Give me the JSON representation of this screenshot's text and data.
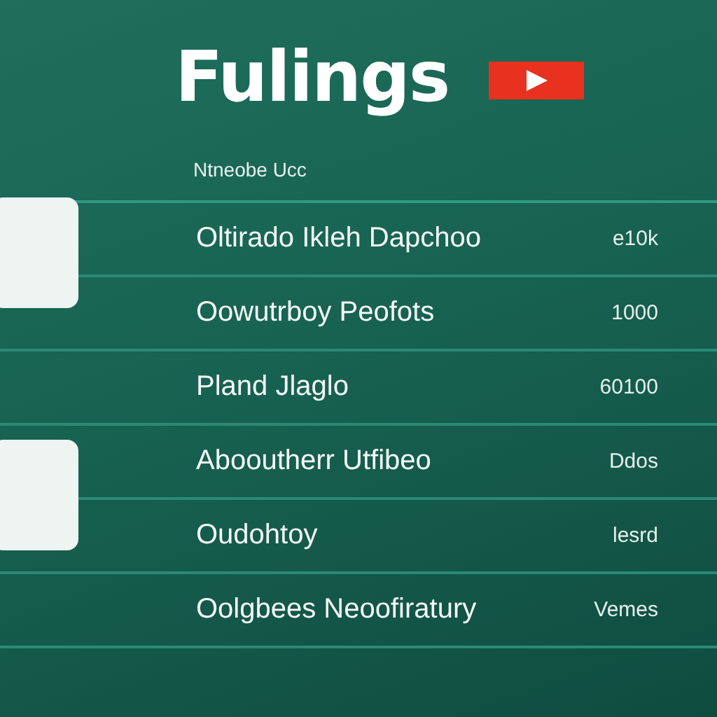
{
  "header": {
    "title": "Fulings",
    "subtitle": "Ntneobe Ucc"
  },
  "rows": [
    {
      "label": "Oltirado Ikleh Dapchoo",
      "value": "e10k"
    },
    {
      "label": "Oowutrboy Peofots",
      "value": "1000"
    },
    {
      "label": "Pland Jlaglo",
      "value": "60100"
    },
    {
      "label": "Abooutherr Utfibeo",
      "value": "Ddos"
    },
    {
      "label": "Oudohtoy",
      "value": "lesrd"
    },
    {
      "label": "Oolgbees Neoofiratury",
      "value": "Vemes"
    }
  ]
}
